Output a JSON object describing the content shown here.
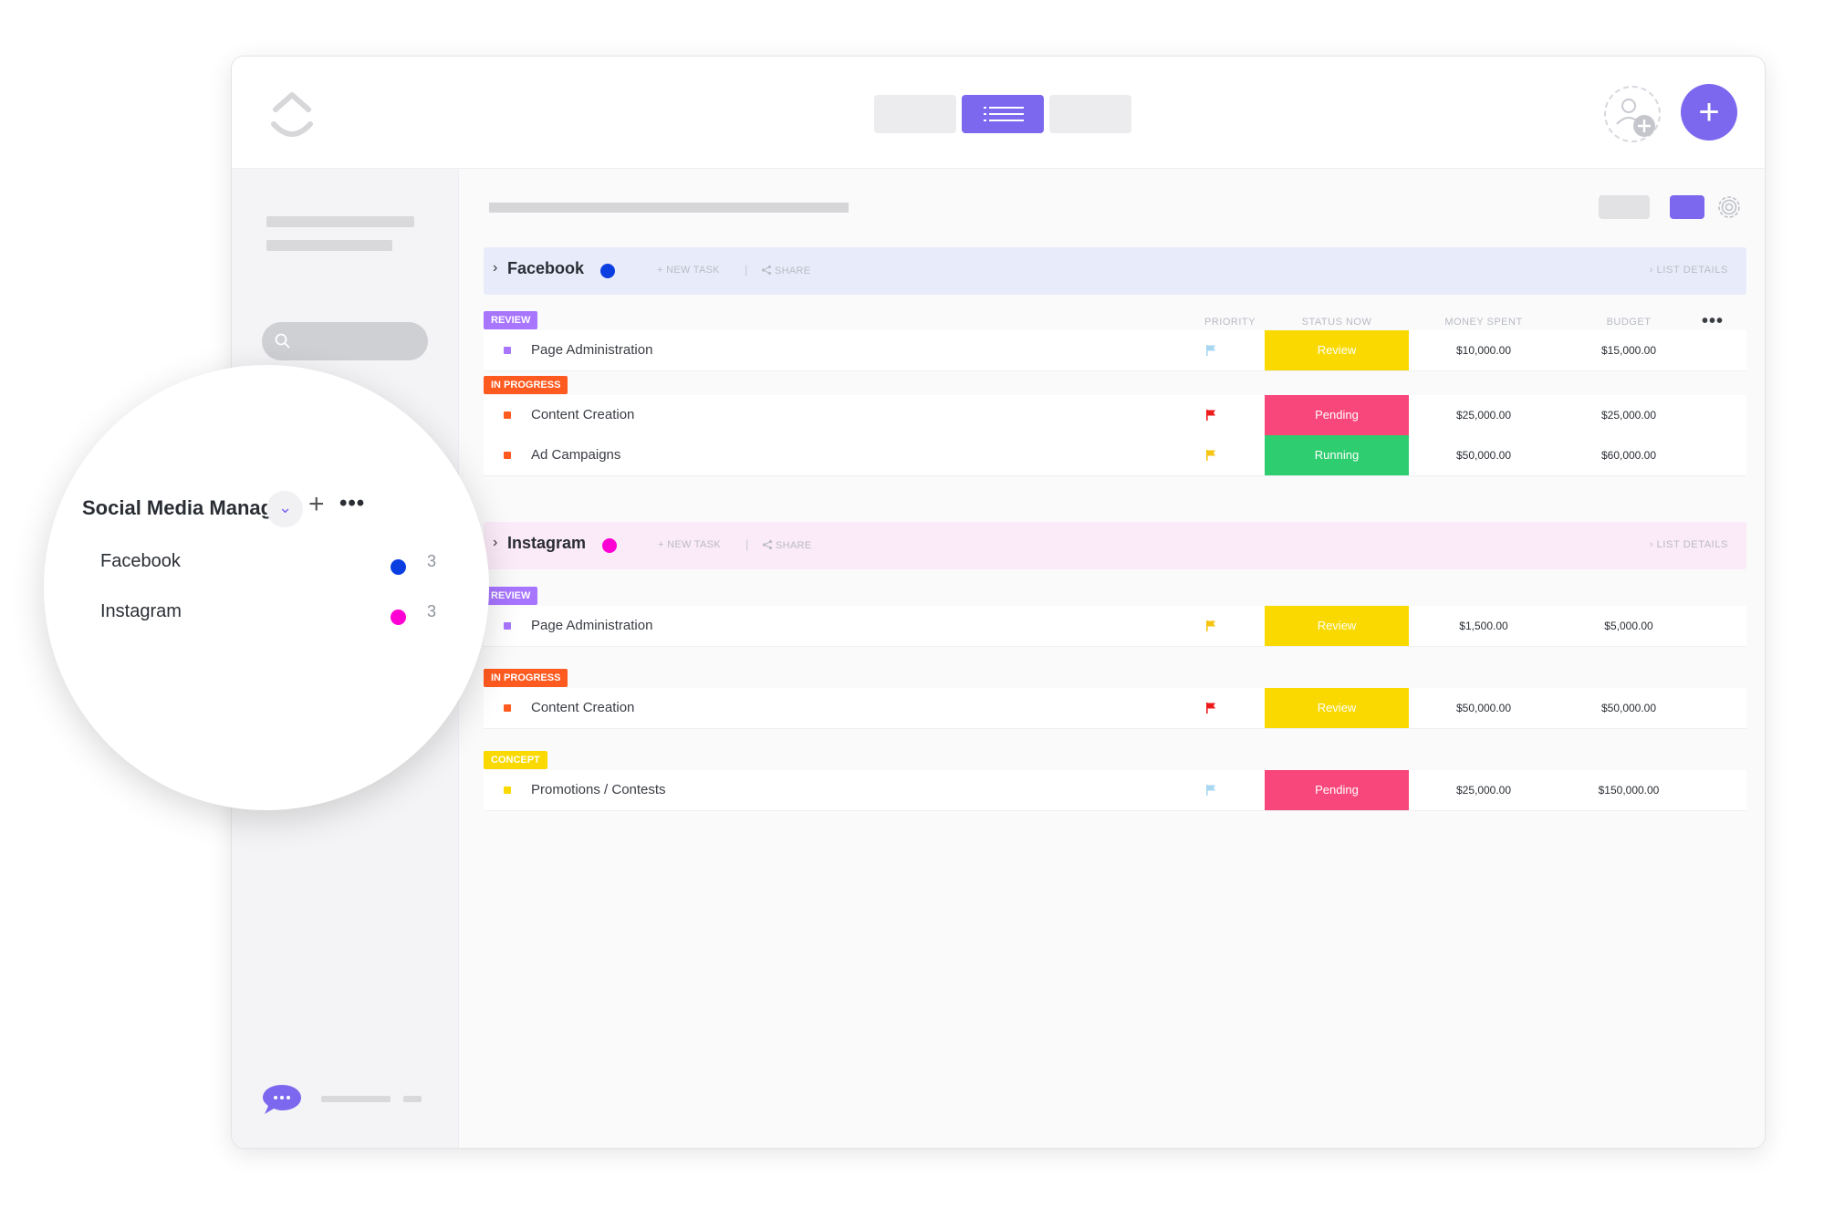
{
  "colors": {
    "accent": "#7b68ee",
    "facebook": "#0b3ee0",
    "instagram": "#ff00d4",
    "review": "#a875ff",
    "in_progress": "#ff5a1f",
    "concept": "#f9d900",
    "status_review": "#f9d900",
    "status_pending": "#f8477a",
    "status_running": "#2ecd6f",
    "facebook_header_bg": "#e8ecfa",
    "instagram_header_bg": "#fbeaf8"
  },
  "icons": {
    "logo": "clickup-logo-icon",
    "list_view": "list-icon",
    "invite": "add-user-icon",
    "add": "plus-icon",
    "settings": "gear-icon",
    "search": "search-icon",
    "chat": "chat-icon",
    "share": "share-icon",
    "flag": "flag-icon"
  },
  "columns": {
    "priority": "PRIORITY",
    "status": "STATUS NOW",
    "spent": "MONEY SPENT",
    "budget": "BUDGET"
  },
  "groups": {
    "facebook": {
      "name": "Facebook",
      "new_task": "+ NEW TASK",
      "sep": "|",
      "share": "SHARE",
      "list_details": "LIST DETAILS",
      "review": {
        "label": "REVIEW",
        "rows": [
          {
            "name": "Page Administration",
            "status": "Review",
            "spent": "$10,000.00",
            "budget": "$15,000.00",
            "priority_color": "#a8d8f0"
          }
        ]
      },
      "in_progress": {
        "label": "IN PROGRESS",
        "rows": [
          {
            "name": "Content Creation",
            "status": "Pending",
            "spent": "$25,000.00",
            "budget": "$25,000.00",
            "priority_color": "#ee1b1b"
          },
          {
            "name": "Ad Campaigns",
            "status": "Running",
            "spent": "$50,000.00",
            "budget": "$60,000.00",
            "priority_color": "#f6c511"
          }
        ]
      }
    },
    "instagram": {
      "name": "Instagram",
      "new_task": "+ NEW TASK",
      "sep": "|",
      "share": "SHARE",
      "list_details": "LIST DETAILS",
      "review": {
        "label": "REVIEW",
        "rows": [
          {
            "name": "Page Administration",
            "status": "Review",
            "spent": "$1,500.00",
            "budget": "$5,000.00",
            "priority_color": "#f6c511"
          }
        ]
      },
      "in_progress": {
        "label": "IN PROGRESS",
        "rows": [
          {
            "name": "Content Creation",
            "status": "Review",
            "spent": "$50,000.00",
            "budget": "$50,000.00",
            "priority_color": "#ee1b1b"
          }
        ]
      },
      "concept": {
        "label": "CONCEPT",
        "rows": [
          {
            "name": "Promotions / Contests",
            "status": "Pending",
            "spent": "$25,000.00",
            "budget": "$150,000.00",
            "priority_color": "#a8d8f0"
          }
        ]
      }
    }
  },
  "magnifier": {
    "title": "Social Media Manage...",
    "more": "•••",
    "plus": "+",
    "chevron": "⌄",
    "items": [
      {
        "name": "Facebook",
        "count": "3"
      },
      {
        "name": "Instagram",
        "count": "3"
      }
    ]
  }
}
